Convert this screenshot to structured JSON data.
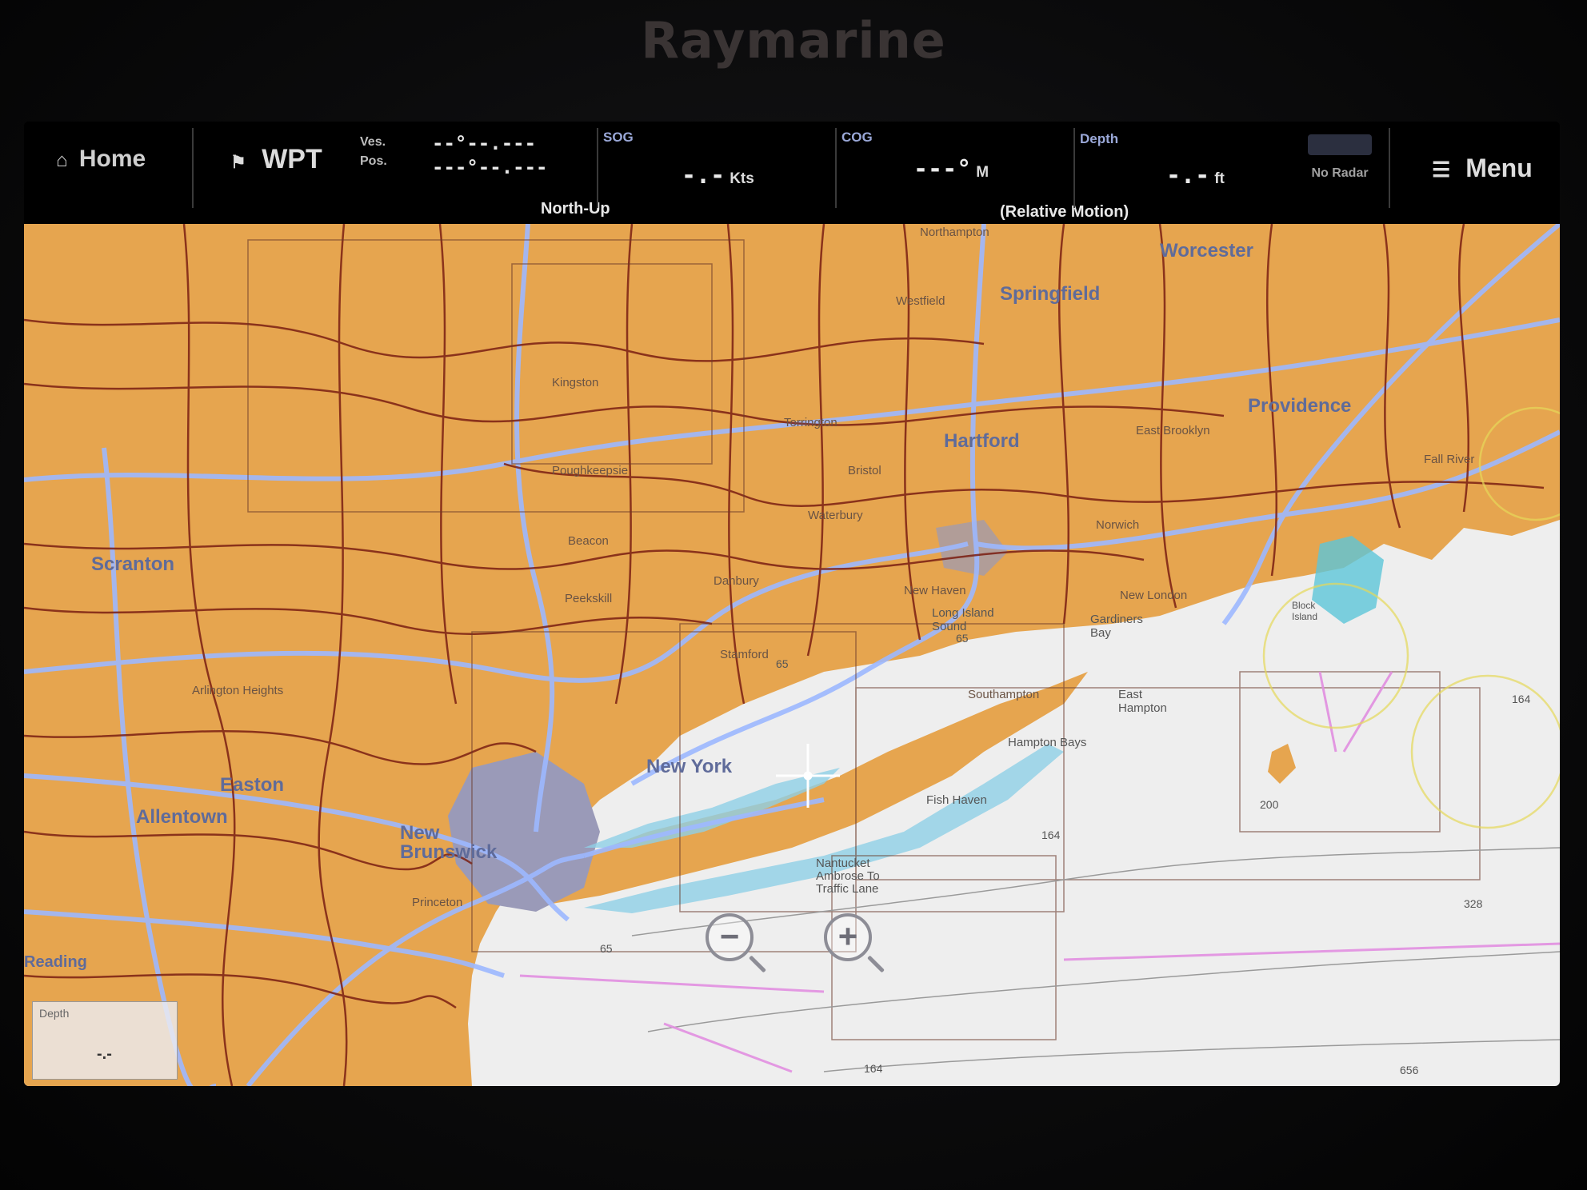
{
  "device": {
    "brand": "Raymarine"
  },
  "databar": {
    "home_label": "Home",
    "wpt_label": "WPT",
    "ves_label": "Ves.",
    "pos_label": "Pos.",
    "pos_line1": "--°--.---",
    "pos_line2": "---°--.---",
    "orientation": "North-Up",
    "sog_label": "SOG",
    "sog_value": "-.-",
    "sog_unit": "Kts",
    "cog_label": "COG",
    "cog_value": "---°",
    "cog_unit": "M",
    "motion_mode": "(Relative Motion)",
    "depth_label": "Depth",
    "depth_value": "-.-",
    "depth_unit": "ft",
    "radar_status": "No Radar",
    "menu_label": "Menu"
  },
  "chart": {
    "colors": {
      "land": "#e6a54f",
      "water": "#eeeeee",
      "shallow": "#8fd0e6",
      "roads_major": "#9db8ff",
      "roads_minor": "#7a1e12",
      "urban": "#9a9ab8"
    },
    "labels": {
      "worcester": "Worcester",
      "springfield": "Springfield",
      "hartford": "Hartford",
      "providence": "Providence",
      "scranton": "Scranton",
      "allentown": "Allentown",
      "easton": "Easton",
      "new_brunswick": "New Brunswick",
      "new_york": "New York",
      "long_island_sound": "Long Island Sound",
      "gardiners_bay": "Gardiners Bay",
      "east_hampton": "East Hampton",
      "hampton_bays": "Hampton Bays",
      "fish_haven": "Fish Haven",
      "nantucket": "Nantucket Ambrose To Traffic Lane",
      "block_island": "Block Island",
      "southampton": "Southampton",
      "northampton": "Northampton",
      "westfield": "Westfield",
      "kingston": "Kingston",
      "poughkeepsie": "Poughkeepsie",
      "torrington": "Torrington",
      "bristol": "Bristol",
      "waterbury": "Waterbury",
      "danbury": "Danbury",
      "peekskill": "Peekskill",
      "new_haven": "New Haven",
      "new_london": "New London",
      "arlington_heights": "Arlington Heights",
      "princeton": "Princeton",
      "reading": "Reading",
      "east_brooklyn": "East Brooklyn",
      "fall_river": "Fall River",
      "norwich": "Norwich",
      "beacon": "Beacon",
      "stamford": "Stamford",
      "depth_65a": "65",
      "depth_65b": "65",
      "depth_65c": "65",
      "depth_164a": "164",
      "depth_164b": "164",
      "depth_164c": "164",
      "depth_200": "200",
      "depth_328": "328",
      "depth_656": "656"
    },
    "depth_widget": {
      "title": "Depth",
      "value": "-.-"
    }
  }
}
